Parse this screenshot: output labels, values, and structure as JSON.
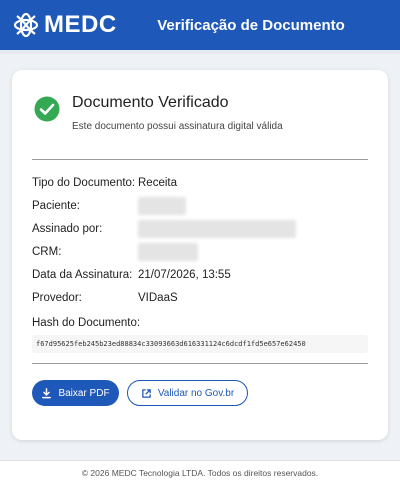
{
  "header": {
    "logo_text": "MEDC",
    "title": "Verificação de Documento"
  },
  "status": {
    "title": "Documento Verificado",
    "subtitle": "Este documento possui assinatura digital válida"
  },
  "details": {
    "tipo_label": "Tipo do Documento:",
    "tipo_value": "Receita",
    "paciente_label": "Paciente:",
    "assinado_label": "Assinado por:",
    "crm_label": "CRM:",
    "data_label": "Data da Assinatura:",
    "data_value": "21/07/2026, 13:55",
    "provedor_label": "Provedor:",
    "provedor_value": "VIDaaS",
    "hash_label": "Hash do Documento:",
    "hash_value": "f67d95625feb245b23ed88834c33093663d616331124c6dcdf1fd5e657e62450"
  },
  "actions": {
    "download_label": "Baixar PDF",
    "validate_label": "Validar no Gov.br"
  },
  "footer": {
    "text": "© 2026 MEDC Tecnologia LTDA. Todos os direitos reservados."
  },
  "colors": {
    "brand": "#1e58b8",
    "success": "#34a853"
  },
  "icons": {
    "logo": "medc-logo-icon",
    "status": "check-circle-icon",
    "download": "download-icon",
    "external": "external-link-icon"
  }
}
